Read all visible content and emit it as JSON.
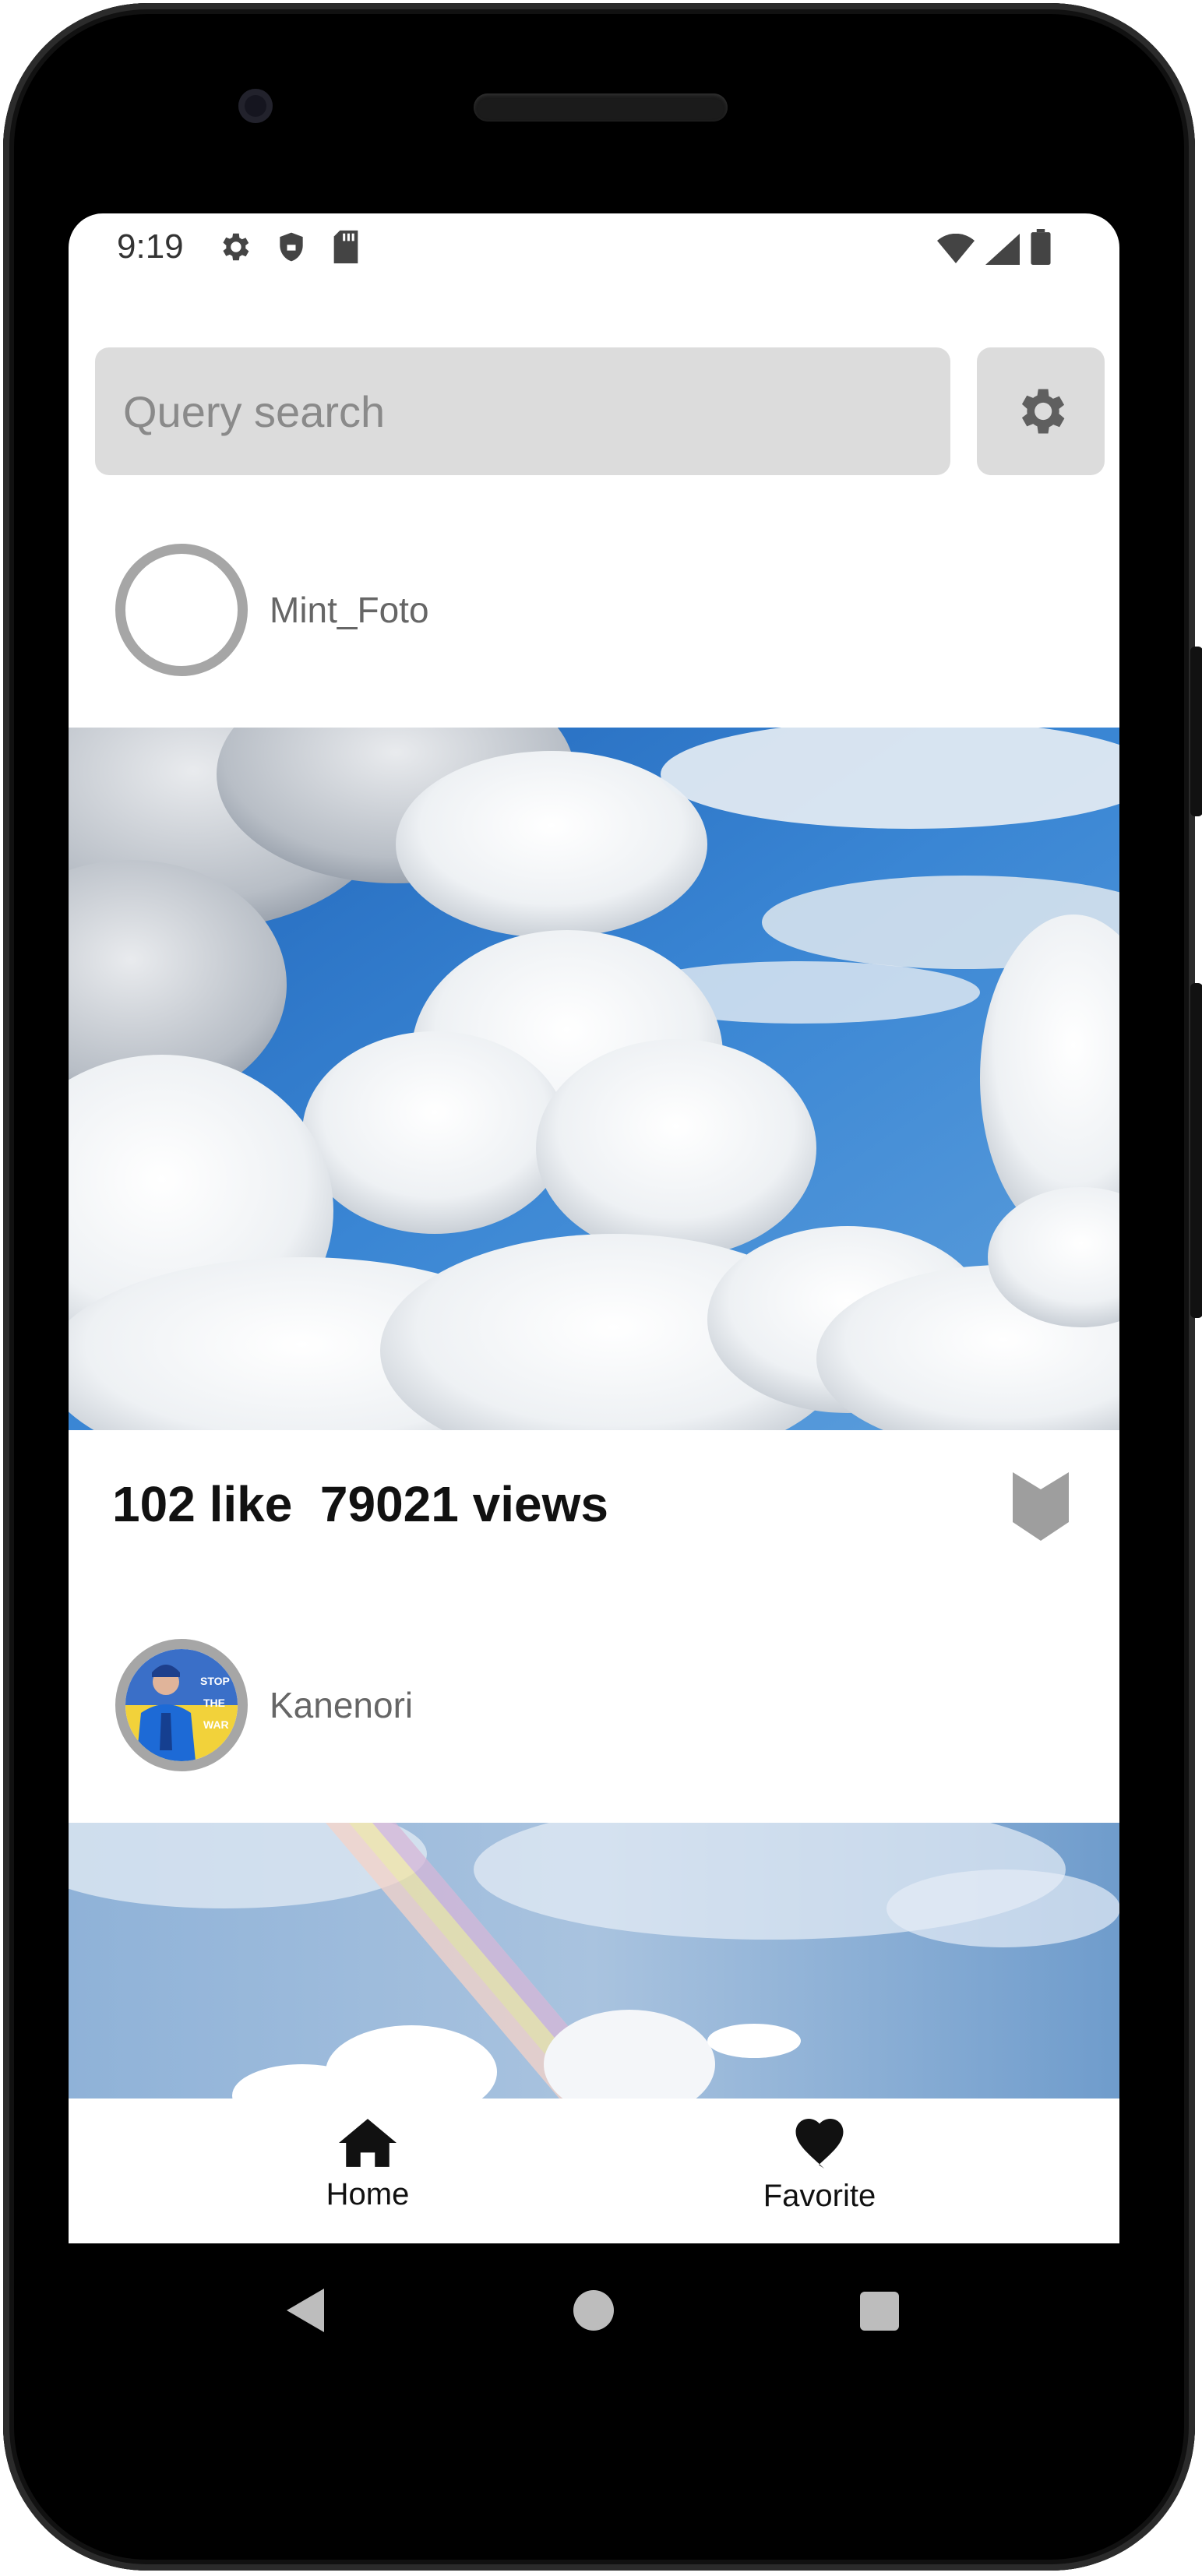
{
  "status_bar": {
    "time": "9:19",
    "left_icons": [
      "gear-icon",
      "shield-icon",
      "sd-card-icon"
    ],
    "right_icons": [
      "wifi-icon",
      "signal-icon",
      "battery-icon"
    ]
  },
  "search": {
    "placeholder": "Query search",
    "value": ""
  },
  "settings_icon": "gear-icon",
  "feed": [
    {
      "author": "Mint_Foto",
      "avatar": "empty-avatar",
      "image": "cloudy-blue-sky-photo",
      "likes_text": "102 like",
      "views_text": "79021 views",
      "bookmark_icon": "bookmark-icon"
    },
    {
      "author": "Kanenori",
      "avatar": "person-in-blue-jacket-avatar",
      "avatar_text": [
        "STOP",
        "THE",
        "WAR"
      ],
      "image": "rainbow-sky-photo"
    }
  ],
  "bottom_nav": {
    "items": [
      {
        "label": "Home",
        "icon": "home-icon"
      },
      {
        "label": "Favorite",
        "icon": "heart-icon"
      }
    ]
  },
  "colors": {
    "search_bg": "#dcdcdc",
    "icon_gray": "#5f5f5f",
    "avatar_ring": "#a6a6a6",
    "bookmark_gray": "#9e9e9e",
    "sky_blue": "#2f78c8"
  }
}
